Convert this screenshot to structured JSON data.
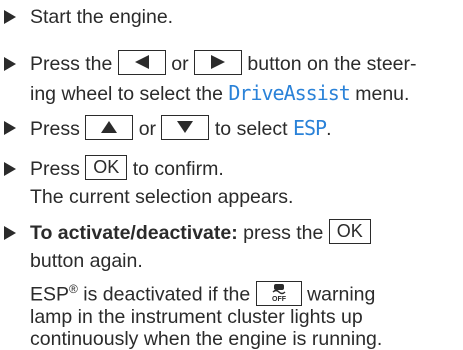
{
  "steps": [
    {
      "line1": "Start the engine."
    },
    {
      "line1_pre": "Press the",
      "line1_or": "or",
      "line1_post": "button on the steer-",
      "line2_pre": "ing wheel to select the",
      "menu": "DriveAssist",
      "line2_post": "menu."
    },
    {
      "pre": "Press",
      "or": "or",
      "mid": "to select",
      "item": "ESP",
      "end": "."
    },
    {
      "pre": "Press",
      "key": "OK",
      "post": "to confirm.",
      "line2": "The current selection appears."
    },
    {
      "bold": "To activate/deactivate:",
      "pre": "press the",
      "key": "OK",
      "line2": "button again.",
      "line3_pre": "ESP",
      "line3_reg": "®",
      "line3_mid": "is deactivated if the",
      "line3_post": "warning",
      "line4": "lamp in the instrument cluster lights up",
      "line5": "continuously when the engine is running."
    }
  ],
  "icons": {
    "left_key": "left-triangle-icon",
    "right_key": "right-triangle-icon",
    "up_key": "up-triangle-icon",
    "down_key": "down-triangle-icon",
    "warning_lamp": "esp-off-warning-lamp-icon"
  },
  "colors": {
    "text": "#2b2b2b",
    "highlight": "#2a82d8"
  }
}
